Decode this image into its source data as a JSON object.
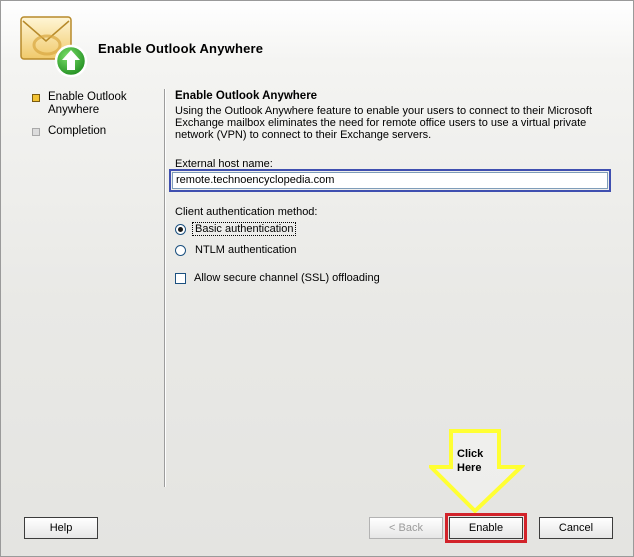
{
  "header": {
    "title": "Enable Outlook Anywhere",
    "icon": "outlook-envelope-upgrade-icon"
  },
  "nav": {
    "items": [
      {
        "label": "Enable Outlook Anywhere",
        "state": "active"
      },
      {
        "label": "Completion",
        "state": "inactive"
      }
    ]
  },
  "content": {
    "section_title": "Enable Outlook Anywhere",
    "description": "Using the Outlook Anywhere feature to enable your users to connect to their Microsoft Exchange mailbox eliminates the need for remote office users to use a virtual private network (VPN) to connect to their Exchange servers.",
    "host_label": "External host name:",
    "host_value": "remote.technoencyclopedia.com",
    "auth_label": "Client authentication method:",
    "auth_options": [
      {
        "label": "Basic authentication",
        "checked": true
      },
      {
        "label": "NTLM authentication",
        "checked": false
      }
    ],
    "ssl_offload_label": "Allow secure channel (SSL) offloading",
    "ssl_offload_checked": false
  },
  "buttons": {
    "help": "Help",
    "back": "< Back",
    "enable": "Enable",
    "cancel": "Cancel"
  },
  "annotation": {
    "text": "Click Here",
    "arrow_color": "#ffff33",
    "highlight_color": "#d2232a",
    "input_highlight_color": "#3f4fb0"
  }
}
